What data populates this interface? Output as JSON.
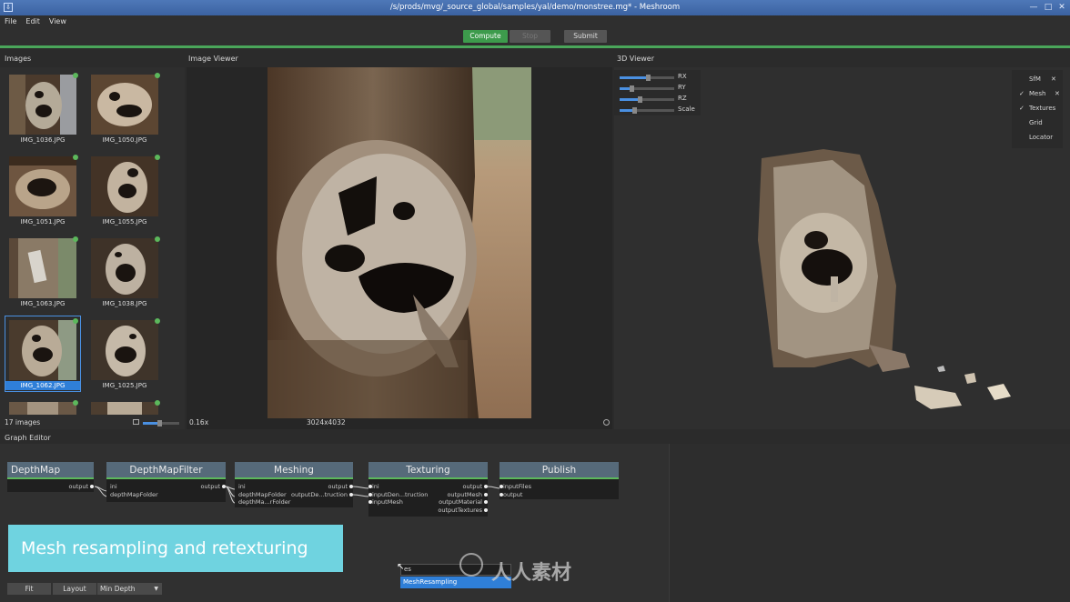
{
  "window": {
    "title": "/s/prods/mvg/_source_global/samples/yal/demo/monstree.mg* - Meshroom",
    "sys_icon": "⇩",
    "minimize": "—",
    "maximize": "□",
    "close": "✕"
  },
  "menu": {
    "file": "File",
    "edit": "Edit",
    "view": "View"
  },
  "toolbar": {
    "compute": "Compute",
    "stop": "Stop",
    "submit": "Submit"
  },
  "images_panel": {
    "title": "Images",
    "count": "17 images",
    "thumbnails": [
      {
        "name": "IMG_1036.JPG"
      },
      {
        "name": "IMG_1050.JPG"
      },
      {
        "name": "IMG_1051.JPG"
      },
      {
        "name": "IMG_1055.JPG"
      },
      {
        "name": "IMG_1063.JPG"
      },
      {
        "name": "IMG_1038.JPG"
      },
      {
        "name": "IMG_1062.JPG",
        "selected": true
      },
      {
        "name": "IMG_1025.JPG"
      }
    ]
  },
  "image_viewer": {
    "title": "Image Viewer",
    "zoom": "0.16x",
    "resolution": "3024x4032"
  },
  "viewer3d": {
    "title": "3D Viewer",
    "sliders": [
      {
        "label": "RX",
        "value": 0.5
      },
      {
        "label": "RY",
        "value": 0.2
      },
      {
        "label": "RZ",
        "value": 0.35
      },
      {
        "label": "Scale",
        "value": 0.25
      }
    ],
    "layers": [
      {
        "label": "SfM",
        "checked": false,
        "removable": true
      },
      {
        "label": "Mesh",
        "checked": true,
        "removable": true
      },
      {
        "label": "Textures",
        "checked": true,
        "removable": false
      },
      {
        "label": "Grid",
        "checked": false,
        "removable": false
      },
      {
        "label": "Locator",
        "checked": false,
        "removable": false
      }
    ]
  },
  "graph_editor": {
    "title": "Graph Editor",
    "nodes": {
      "depthmap": {
        "title": "DepthMap",
        "outputs": [
          "output"
        ]
      },
      "depthmapfilter": {
        "title": "DepthMapFilter",
        "inputs": [
          "ini",
          "depthMapFolder"
        ],
        "outputs": [
          "output"
        ]
      },
      "meshing": {
        "title": "Meshing",
        "inputs": [
          "ini",
          "depthMapFolder",
          "depthMa...rFolder"
        ],
        "outputs": [
          "output",
          "outputDe...truction"
        ]
      },
      "texturing": {
        "title": "Texturing",
        "inputs": [
          "ini",
          "inputDen...truction",
          "inputMesh"
        ],
        "outputs": [
          "output",
          "outputMesh",
          "outputMaterial",
          "outputTextures"
        ]
      },
      "publish": {
        "title": "Publish",
        "inputs": [
          "inputFiles",
          "output"
        ]
      }
    },
    "banner": "Mesh resampling and retexturing",
    "search_text": "es",
    "search_result": "MeshResampling",
    "buttons": {
      "fit": "Fit",
      "layout": "Layout",
      "depth": "Min Depth"
    }
  },
  "watermark": "人人素材",
  "colors": {
    "accent_green": "#4aa65a",
    "selection_blue": "#2f7fd8",
    "banner": "#6fd3e0"
  }
}
